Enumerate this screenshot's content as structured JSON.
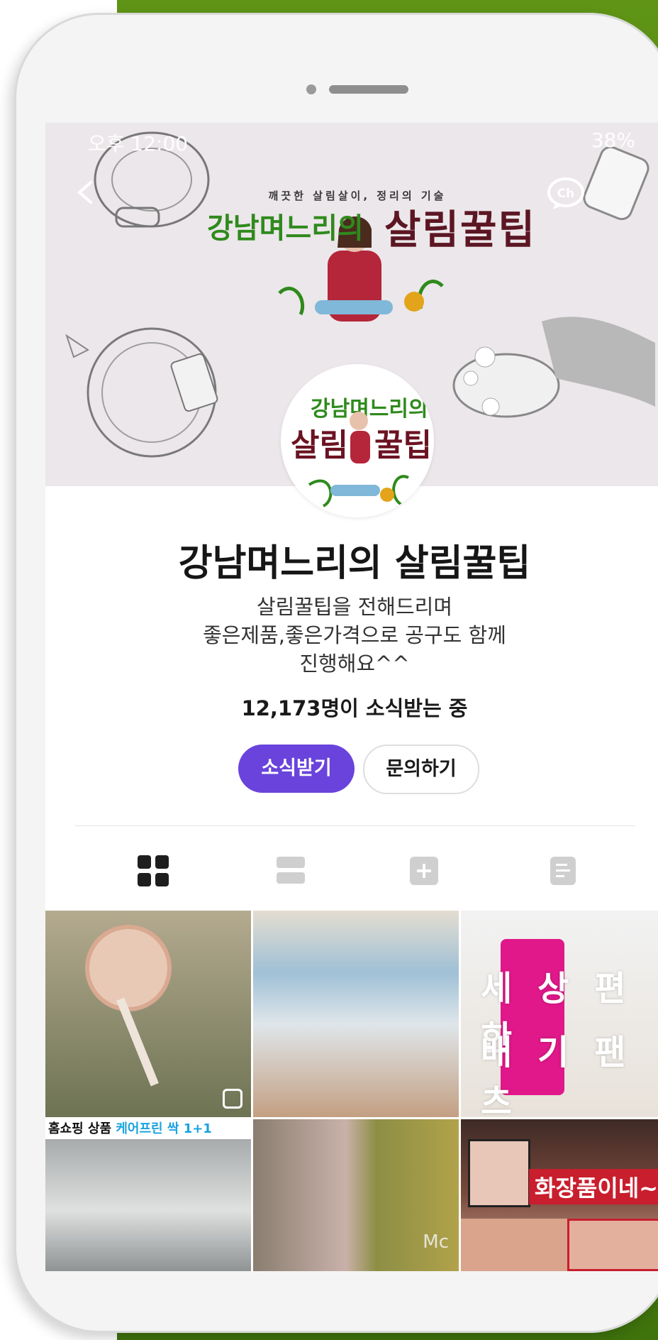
{
  "cover": {
    "status_time": "오후 12:00",
    "status_right": "38%",
    "tagline": "깨끗한 살림살이, 정리의 기술",
    "brand_line1": "강남며느리의",
    "brand_line2": "살림꿀팁",
    "ch_icon": "channel-icon"
  },
  "profile": {
    "logo_line1": "강남며느리의",
    "logo_line2a": "살림",
    "logo_line2b": "꿀팁",
    "name": "강남며느리의 살림꿀팁",
    "description_line1": "살림꿀팁을 전해드리며",
    "description_line2": "좋은제품,좋은가격으로 공구도 함께",
    "description_line3": "진행해요^^",
    "subscribers": "12,173명이 소식받는 중"
  },
  "actions": {
    "subscribe_label": "소식받기",
    "inquiry_label": "문의하기"
  },
  "tabs": [
    {
      "icon": "grid-view-icon",
      "active": true
    },
    {
      "icon": "list-view-icon",
      "active": false
    },
    {
      "icon": "plus-icon",
      "active": false
    },
    {
      "icon": "document-icon",
      "active": false
    }
  ],
  "posts": {
    "post3_overlay1": "세상편한",
    "post3_overlay2": "배기팬츠",
    "post4_banner_a": "홈쇼핑 상품",
    "post4_banner_b": "케어프린 싹 1+1",
    "post5_watermark": "Mc",
    "post6_caption": "화장품이네~"
  },
  "colors": {
    "accent": "#6a43dc",
    "background_green": "#4b8110",
    "brand_green": "#2f8a1d",
    "brand_maroon": "#5c1623"
  }
}
